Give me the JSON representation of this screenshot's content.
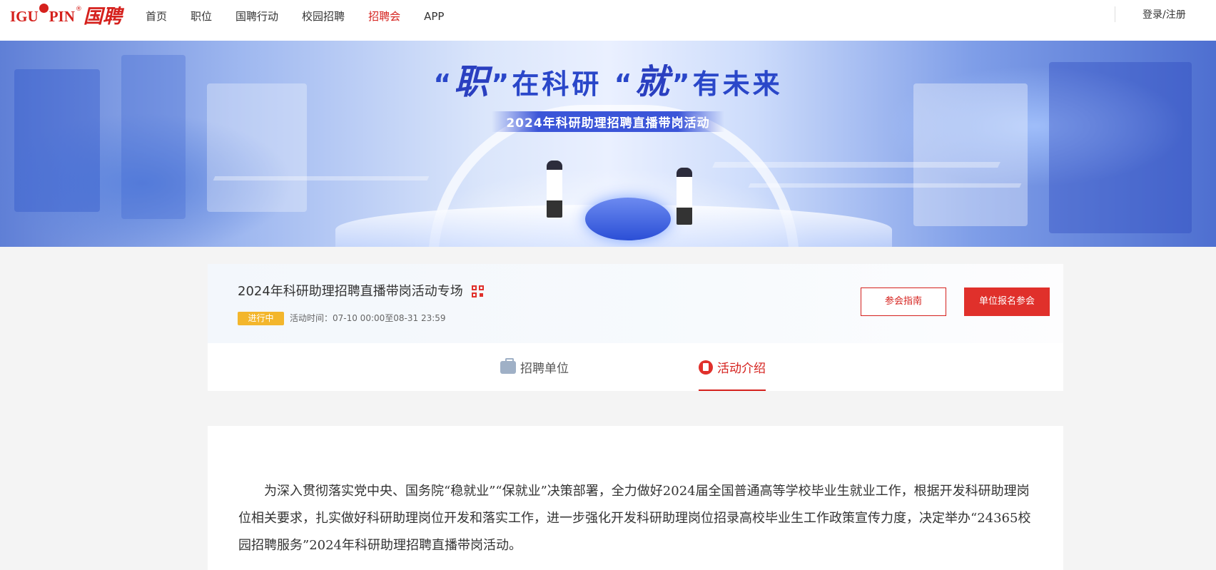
{
  "header": {
    "logo_text": "IGU",
    "logo_text_2": "PIN",
    "logo_reg": "®",
    "logo_cn": "国聘",
    "nav": [
      "首页",
      "职位",
      "国聘行动",
      "校园招聘",
      "招聘会",
      "APP"
    ],
    "active_nav": "招聘会",
    "login_label": "登录/注册"
  },
  "banner": {
    "slogan_q1_open": "“",
    "slogan_zhi": "职",
    "slogan_q1_close": "”",
    "slogan_mid": "在科研",
    "slogan_q2_open": "“",
    "slogan_jiu": "就",
    "slogan_q2_close": "”",
    "slogan_end": "有未来",
    "subtitle": "2024年科研助理招聘直播带岗活动"
  },
  "event": {
    "title": "2024年科研助理招聘直播带岗活动专场",
    "status": "进行中",
    "time_label": "活动时间：07-10 00:00至08-31 23:59",
    "guide_button": "参会指南",
    "signup_button": "单位报名参会"
  },
  "tabs": {
    "units": "招聘单位",
    "intro": "活动介绍"
  },
  "content": {
    "paragraph": "为深入贯彻落实党中央、国务院“稳就业”“保就业”决策部署，全力做好2024届全国普通高等学校毕业生就业工作，根据开发科研助理岗位相关要求，扎实做好科研助理岗位开发和落实工作，进一步强化开发科研助理岗位招录高校毕业生工作政策宣传力度，决定举办“24365校园招聘服务”2024年科研助理招聘直播带岗活动。"
  },
  "colors": {
    "brand_red": "#d5211d",
    "status_yellow": "#f3b62c",
    "banner_blue": "#2a47c9"
  }
}
